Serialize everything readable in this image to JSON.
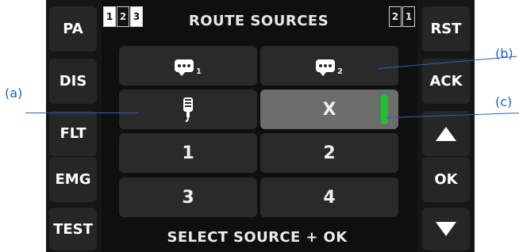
{
  "left_buttons": [
    {
      "label": "PA"
    },
    {
      "label": "DIS"
    },
    {
      "label": "FLT"
    },
    {
      "label": "EMG"
    },
    {
      "label": "TEST"
    }
  ],
  "right_buttons": {
    "rst": "RST",
    "ack": "ACK",
    "ok": "OK"
  },
  "header": {
    "title": "ROUTE SOURCES",
    "left_numbers": [
      "1",
      "2",
      "3"
    ],
    "right_numbers": [
      "2",
      "1"
    ]
  },
  "tiles": {
    "row1": {
      "left_sub": "1",
      "right_sub": "2"
    },
    "row2": {
      "right_label": "X"
    },
    "row3": {
      "left_label": "1",
      "right_label": "2"
    },
    "row4": {
      "left_label": "3",
      "right_label": "4"
    }
  },
  "footer": {
    "text": "SELECT SOURCE + OK"
  },
  "callouts": {
    "a": "(a)",
    "b": "(b)",
    "c": "(c)"
  },
  "colors": {
    "selected_indicator": "#1fbf2f",
    "callout_line": "#2a5fc6"
  },
  "icons": {
    "chat_bubble": "speech-bubble-icon",
    "microphone": "handheld-microphone-icon",
    "up": "up-arrow-icon",
    "down": "down-arrow-icon"
  }
}
